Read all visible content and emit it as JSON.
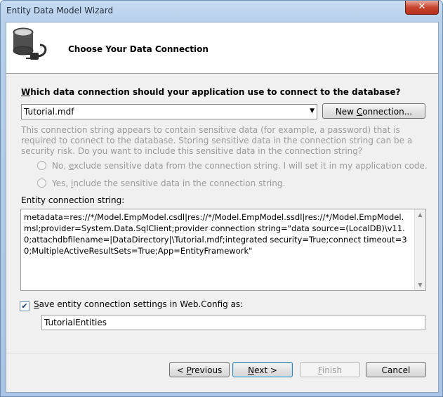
{
  "window": {
    "title": "Entity Data Model Wizard",
    "close_glyph": "✕"
  },
  "header": {
    "title": "Choose Your Data Connection",
    "icon": "database-plug-icon"
  },
  "question": {
    "underlined": "W",
    "rest": "hich data connection should your application use to connect to the database?"
  },
  "connection": {
    "selected": "Tutorial.mdf",
    "arrow": "▼"
  },
  "new_connection": {
    "pre": "New ",
    "underlined": "C",
    "post": "onnection..."
  },
  "info_text": "This connection string appears to contain sensitive data (for example, a password) that is required to connect to the database. Storing sensitive data in the connection string can be a security risk. Do you want to include this sensitive data in the connection string?",
  "radio_no": {
    "pre": "No, ",
    "underlined": "e",
    "post": "xclude sensitive data from the connection string. I will set it in my application code."
  },
  "radio_yes": {
    "pre": "Yes, ",
    "underlined": "i",
    "post": "nclude the sensitive data in the connection string."
  },
  "ecs": {
    "label": "Entity connection string:",
    "value": "metadata=res://*/Model.EmpModel.csdl|res://*/Model.EmpModel.ssdl|res://*/Model.EmpModel.msl;provider=System.Data.SqlClient;provider connection string=\"data source=(LocalDB)\\v11.0;attachdbfilename=|DataDirectory|\\Tutorial.mdf;integrated security=True;connect timeout=30;MultipleActiveResultSets=True;App=EntityFramework\""
  },
  "scroll": {
    "up": "▲",
    "down": "▼"
  },
  "save_settings": {
    "checked": true,
    "check_glyph": "✔",
    "underlined": "S",
    "rest": "ave entity connection settings in Web.Config as:"
  },
  "entities_name": "TutorialEntities",
  "buttons": {
    "previous": {
      "pre": "< ",
      "underlined": "P",
      "post": "revious"
    },
    "next": {
      "underlined": "N",
      "post": "ext >"
    },
    "finish": {
      "underlined": "F",
      "post": "inish"
    },
    "cancel": "Cancel"
  }
}
